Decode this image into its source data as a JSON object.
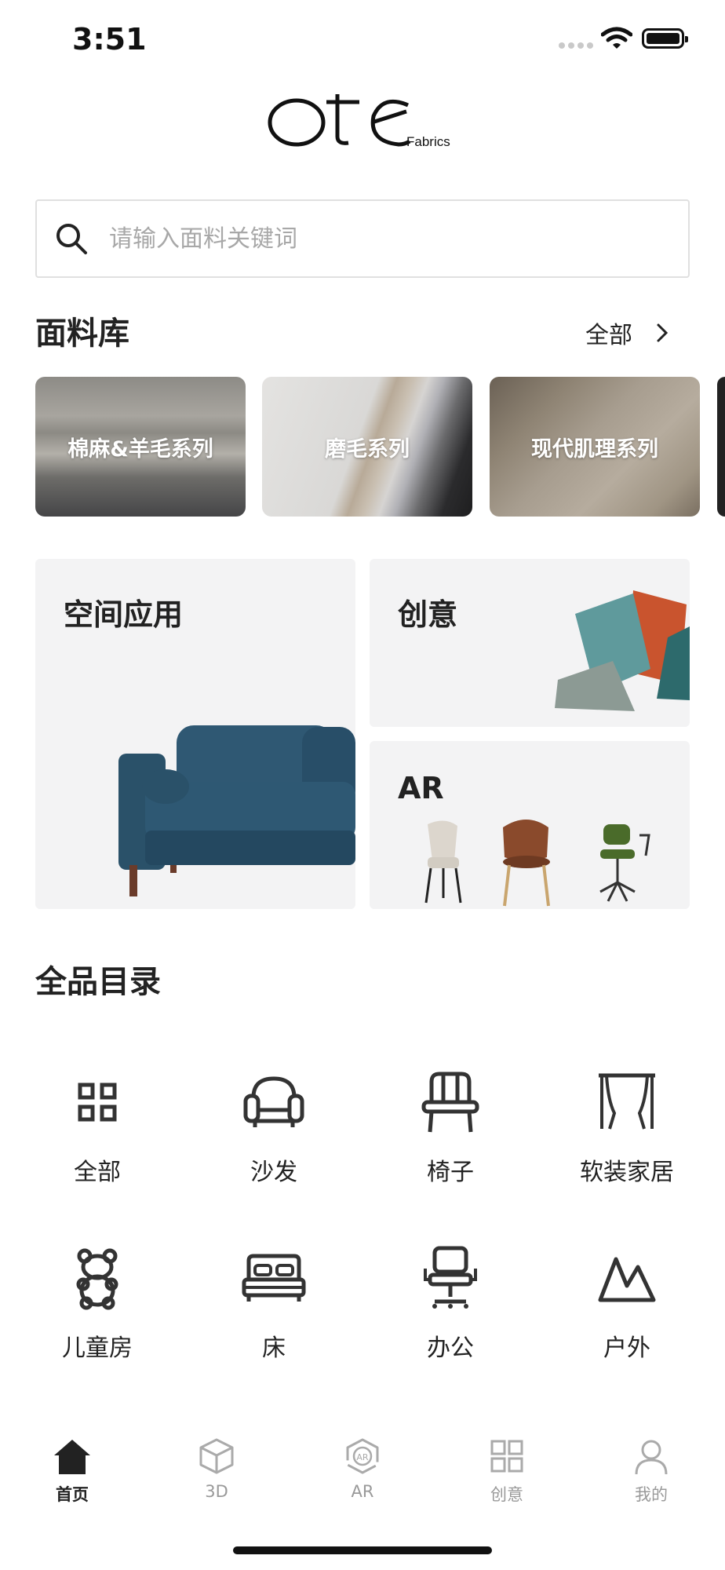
{
  "status_bar": {
    "time": "3:51"
  },
  "brand": {
    "logo_text": "ote",
    "logo_sub": "Fabrics"
  },
  "search": {
    "placeholder": "请输入面料关键词"
  },
  "fabric_library": {
    "title": "面料库",
    "all_label": "全部",
    "items": [
      {
        "label": "棉麻&羊毛系列"
      },
      {
        "label": "磨毛系列"
      },
      {
        "label": "现代肌理系列"
      }
    ]
  },
  "features": {
    "space": {
      "title": "空间应用"
    },
    "creative": {
      "title": "创意"
    },
    "ar": {
      "title": "AR"
    }
  },
  "catalog": {
    "title": "全品目录",
    "items": [
      {
        "label": "全部",
        "icon": "grid-icon"
      },
      {
        "label": "沙发",
        "icon": "sofa-icon"
      },
      {
        "label": "椅子",
        "icon": "chair-icon"
      },
      {
        "label": "软装家居",
        "icon": "curtain-icon"
      },
      {
        "label": "儿童房",
        "icon": "teddy-bear-icon"
      },
      {
        "label": "床",
        "icon": "bed-icon"
      },
      {
        "label": "办公",
        "icon": "office-chair-icon"
      },
      {
        "label": "户外",
        "icon": "mountain-icon"
      }
    ]
  },
  "tabbar": {
    "items": [
      {
        "label": "首页",
        "icon": "home-icon",
        "active": true
      },
      {
        "label": "3D",
        "icon": "cube-icon",
        "active": false
      },
      {
        "label": "AR",
        "icon": "ar-icon",
        "active": false
      },
      {
        "label": "创意",
        "icon": "grid-icon",
        "active": false
      },
      {
        "label": "我的",
        "icon": "user-icon",
        "active": false
      }
    ]
  },
  "colors": {
    "accent": "#222222",
    "tab_inactive": "#999999",
    "tile_bg": "#f3f3f4"
  }
}
